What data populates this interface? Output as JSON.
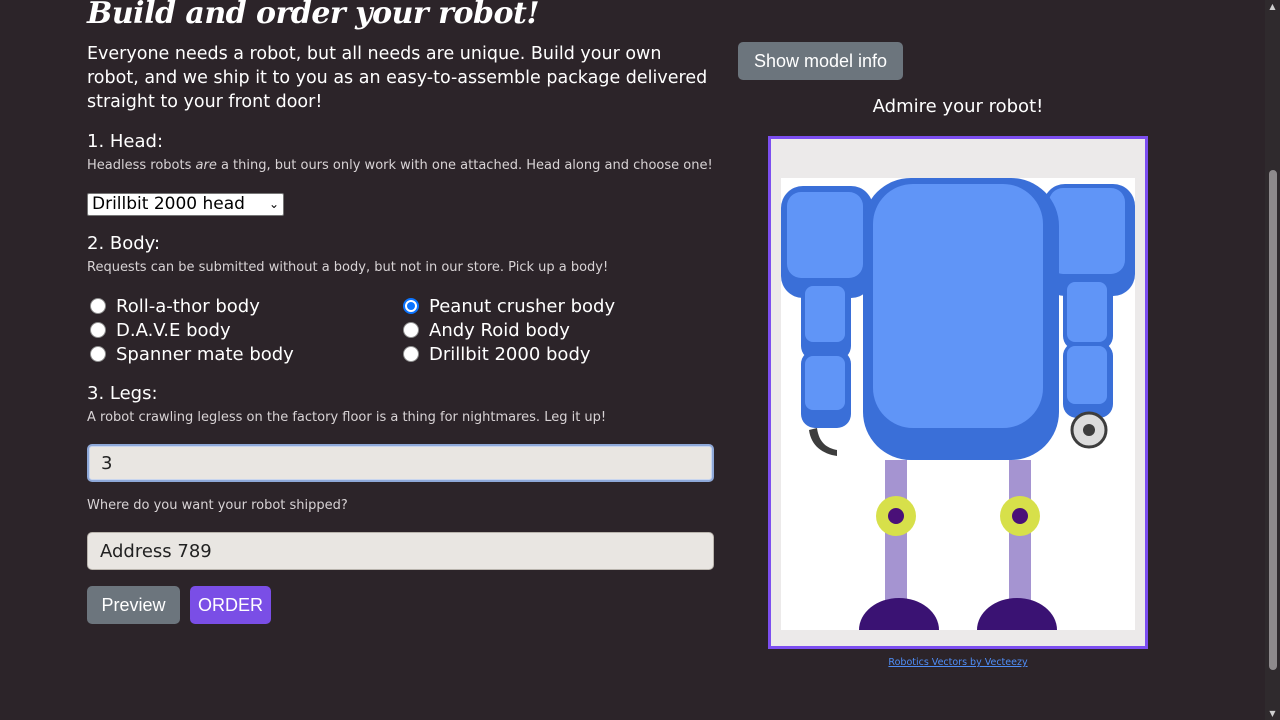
{
  "page": {
    "title": "Build and order your robot!",
    "intro": "Everyone needs a robot, but all needs are unique. Build your own robot, and we ship it to you as an easy-to-assemble package delivered straight to your front door!"
  },
  "head": {
    "heading": "1. Head:",
    "hint_before": "Headless robots ",
    "hint_emphasis": "are",
    "hint_after": " a thing, but ours only work with one attached. Head along and choose one!",
    "selected": "Drillbit 2000 head"
  },
  "body": {
    "heading": "2. Body:",
    "hint": "Requests can be submitted without a body, but not in our store. Pick up a body!",
    "options": [
      {
        "label": "Roll-a-thor body",
        "checked": false
      },
      {
        "label": "Peanut crusher body",
        "checked": true
      },
      {
        "label": "D.A.V.E body",
        "checked": false
      },
      {
        "label": "Andy Roid body",
        "checked": false
      },
      {
        "label": "Spanner mate body",
        "checked": false
      },
      {
        "label": "Drillbit 2000 body",
        "checked": false
      }
    ]
  },
  "legs": {
    "heading": "3. Legs:",
    "hint": "A robot crawling legless on the factory floor is a thing for nightmares. Leg it up!",
    "value": "3"
  },
  "shipping": {
    "label": "Where do you want your robot shipped?",
    "value": "Address 789"
  },
  "buttons": {
    "preview": "Preview",
    "order": "ORDER",
    "model_info": "Show model info"
  },
  "preview": {
    "caption": "Admire your robot!",
    "credit": "Robotics Vectors by Vecteezy"
  },
  "colors": {
    "background": "#2c2429",
    "accent": "#7a4ee6",
    "robot_body": "#6095f7",
    "robot_body_shadow": "#3a6fd8",
    "legs": "#a594d1",
    "joints": "#d7e04a",
    "feet": "#3a1273"
  }
}
